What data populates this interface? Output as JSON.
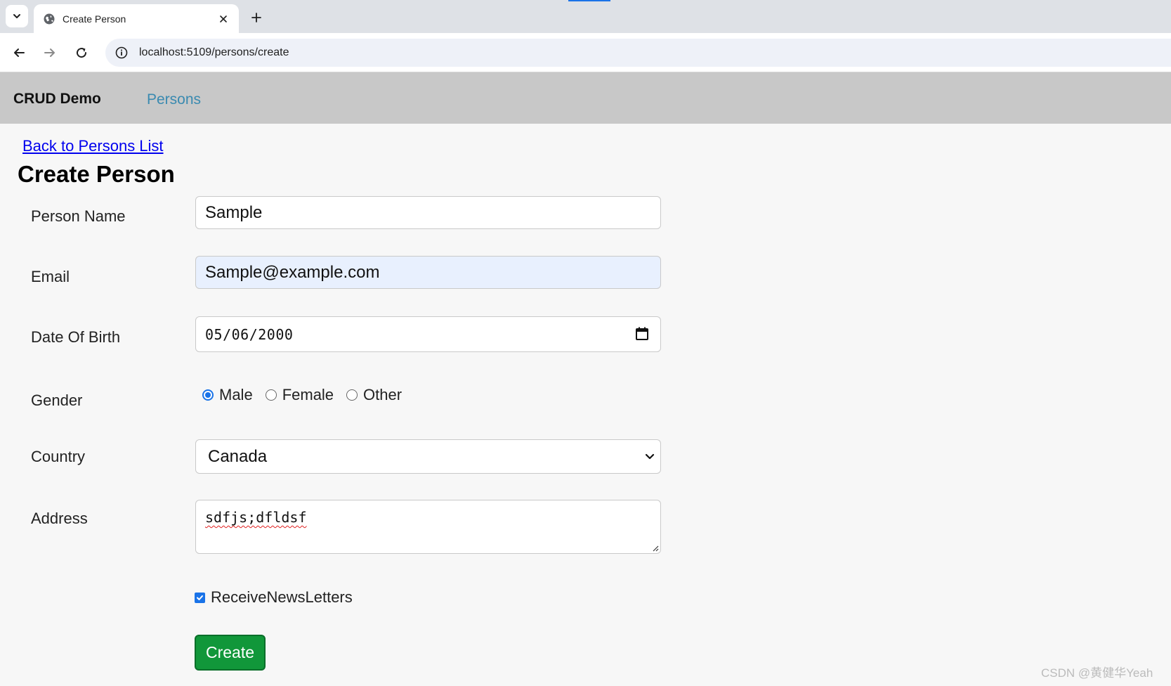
{
  "browser": {
    "tab_title": "Create Person",
    "url": "localhost:5109/persons/create"
  },
  "navbar": {
    "brand": "CRUD Demo",
    "link": "Persons"
  },
  "page": {
    "back_link": "Back to Persons List",
    "title": "Create Person"
  },
  "form": {
    "person_name": {
      "label": "Person Name",
      "value": "Sample"
    },
    "email": {
      "label": "Email",
      "value": "Sample@example.com"
    },
    "dob": {
      "label": "Date Of Birth",
      "value": "05/06/2000"
    },
    "gender": {
      "label": "Gender",
      "options": [
        "Male",
        "Female",
        "Other"
      ],
      "selected": "Male"
    },
    "country": {
      "label": "Country",
      "value": "Canada"
    },
    "address": {
      "label": "Address",
      "value": "sdfjs;dfldsf"
    },
    "newsletter": {
      "label": "ReceiveNewsLetters",
      "checked": true
    },
    "submit_label": "Create"
  },
  "watermark": "CSDN @黄健华Yeah",
  "colors": {
    "accent": "#1a73e8",
    "create_button": "#11973a",
    "navbar_bg": "#c8c8c8",
    "nav_link": "#3a8ab0",
    "autofill_bg": "#e8f0fe"
  }
}
